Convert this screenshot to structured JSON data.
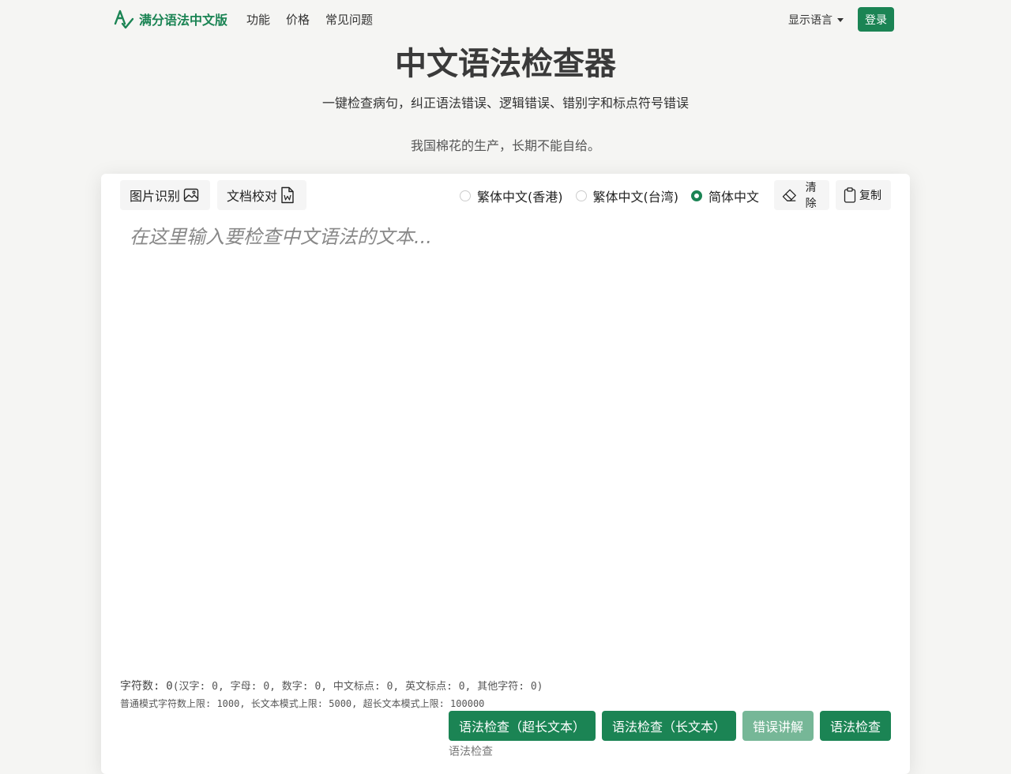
{
  "colors": {
    "brand": "#1b8454",
    "brand_disabled": "#76b797",
    "background": "#f5f5f3"
  },
  "navbar": {
    "brand_name": "满分语法中文版",
    "logo_icon": "check-logo-icon",
    "links": [
      "功能",
      "价格",
      "常见问题"
    ],
    "language_label": "显示语言",
    "login_label": "登录"
  },
  "hero": {
    "title": "中文语法检查器",
    "subtitle": "一键检查病句，纠正语法错误、逻辑错误、错别字和标点符号错误",
    "example": "我国棉花的生产，长期不能自给。"
  },
  "toolbar": {
    "image_ocr_label": "图片识别",
    "doc_proof_label": "文档校对",
    "clear_label": "清除",
    "copy_label": "复制",
    "variants": [
      {
        "label": "繁体中文(香港)",
        "checked": false
      },
      {
        "label": "繁体中文(台湾)",
        "checked": false
      },
      {
        "label": "简体中文",
        "checked": true
      }
    ]
  },
  "editor": {
    "placeholder": "在这里输入要检查中文语法的文本..."
  },
  "stats": {
    "count_label": "字符数:",
    "count_value": "0",
    "breakdown": "(汉字: 0, 字母: 0, 数字: 0, 中文标点: 0, 英文标点: 0, 其他字符: 0)",
    "limits": "普通模式字符数上限: 1000, 长文本模式上限: 5000, 超长文本模式上限: 100000"
  },
  "actions": {
    "super_long_label": "语法检查（超长文本）",
    "long_label": "语法检查（长文本）",
    "explain_label": "错误讲解",
    "check_label": "语法检查",
    "status": "语法检查"
  }
}
